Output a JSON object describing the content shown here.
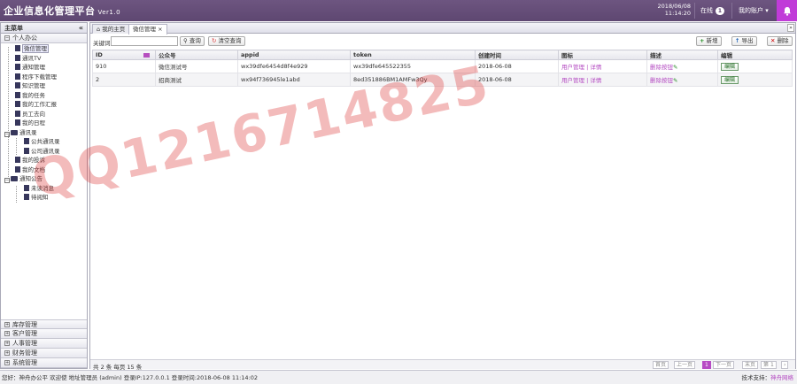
{
  "header": {
    "app_title": "企业信息化管理平台",
    "version": "Ver1.0",
    "date": "2018/06/08",
    "time": "11:14:20",
    "online_label": "在线",
    "online_count": "1",
    "account_label": "我的账户",
    "account_caret": "▾"
  },
  "sidebar": {
    "title": "主菜单",
    "collapse_glyph": "«",
    "top_section": "个人办公",
    "tree": [
      {
        "label": "微信管理",
        "type": "leaf",
        "selected": true
      },
      {
        "label": "通讯TV",
        "type": "leaf"
      },
      {
        "label": "通知管理",
        "type": "leaf"
      },
      {
        "label": "程序下载管理",
        "type": "leaf"
      },
      {
        "label": "知识管理",
        "type": "leaf"
      },
      {
        "label": "我的任务",
        "type": "leaf"
      },
      {
        "label": "我的工作汇报",
        "type": "leaf"
      },
      {
        "label": "员工去向",
        "type": "leaf"
      },
      {
        "label": "我的日程",
        "type": "leaf"
      },
      {
        "label": "通讯录",
        "type": "folder"
      },
      {
        "label": "公共通讯录",
        "type": "child"
      },
      {
        "label": "公司通讯录",
        "type": "child"
      },
      {
        "label": "我的投诉",
        "type": "leaf"
      },
      {
        "label": "我的文档",
        "type": "leaf"
      },
      {
        "label": "通知公告",
        "type": "folder"
      },
      {
        "label": "未读消息",
        "type": "child"
      },
      {
        "label": "待阅知",
        "type": "child"
      }
    ],
    "bottom_sections": [
      "库存管理",
      "客户管理",
      "人事管理",
      "财务管理",
      "系统管理"
    ]
  },
  "tabs": [
    {
      "label": "我的主页"
    },
    {
      "label": "微信管理"
    }
  ],
  "toolbar": {
    "keyword_label": "关键词:",
    "keyword_value": "",
    "search_label": "查询",
    "reset_label": "清空查询",
    "add_label": "新增",
    "export_label": "导出",
    "delete_label": "删除"
  },
  "table": {
    "columns": [
      "ID",
      "公众号",
      "appid",
      "token",
      "创建时间",
      "图标",
      "描述",
      "编辑"
    ],
    "rows": [
      {
        "id": "910",
        "name": "微信测试号",
        "appid": "wx39dfe6454d8f4e929",
        "token": "wx39dfe645522355",
        "created": "2018-06-08",
        "icon": "用户管理 | 详情",
        "desc": "删除按钮",
        "edit": "编辑"
      },
      {
        "id": "2",
        "name": "招商测试",
        "appid": "wx94f736945le1abd",
        "token": "8ed351886BM1AMFw3Qy",
        "created": "2018-06-08",
        "icon": "用户管理 | 详情",
        "desc": "删除按钮",
        "edit": "编辑"
      }
    ]
  },
  "pager": {
    "total_text": "共 2 条 每页 15 条",
    "first": "首页",
    "prev": "上一页",
    "current": "1",
    "next": "下一页",
    "last": "末页",
    "goto_label": "第",
    "goto_value": "1",
    "arrow": "›"
  },
  "status": {
    "left": "您好：神舟办公平 欢迎使 地址管理员 (admin) 登录IP:127.0.0.1 登录时间:2018-06-08 11:14:02",
    "right_label": "技术支持：",
    "right_link": "神舟网络"
  },
  "watermark": "QQ1216714825",
  "colors": {
    "header": "#5e4771",
    "accent": "#b74bc4",
    "bell": "#c03bd8"
  }
}
